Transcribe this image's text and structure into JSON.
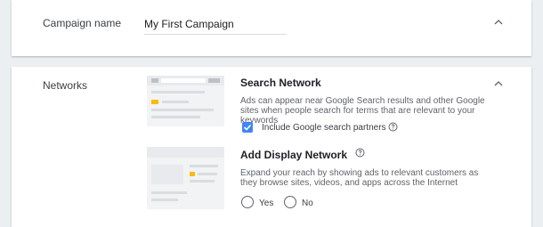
{
  "campaign": {
    "label": "Campaign name",
    "value": "My First Campaign",
    "collapse_icon": "chevron-up-icon"
  },
  "networks": {
    "label": "Networks",
    "collapse_icon": "chevron-up-icon",
    "search": {
      "title": "Search Network",
      "description": "Ads can appear near Google Search results and other Google sites when people search for terms that are relevant to your keywords",
      "partners_label": "Include Google search partners",
      "partners_checked": true,
      "help_icon": "help-circle-icon"
    },
    "display": {
      "title": "Add Display Network",
      "help_icon": "help-circle-icon",
      "description": "Expand your reach by showing ads to relevant customers as they browse sites, videos, and apps across the Internet",
      "options": [
        "Yes",
        "No"
      ]
    }
  },
  "colors": {
    "accent": "#4285f4",
    "highlight": "#fbbc04",
    "background": "#eceff1"
  }
}
